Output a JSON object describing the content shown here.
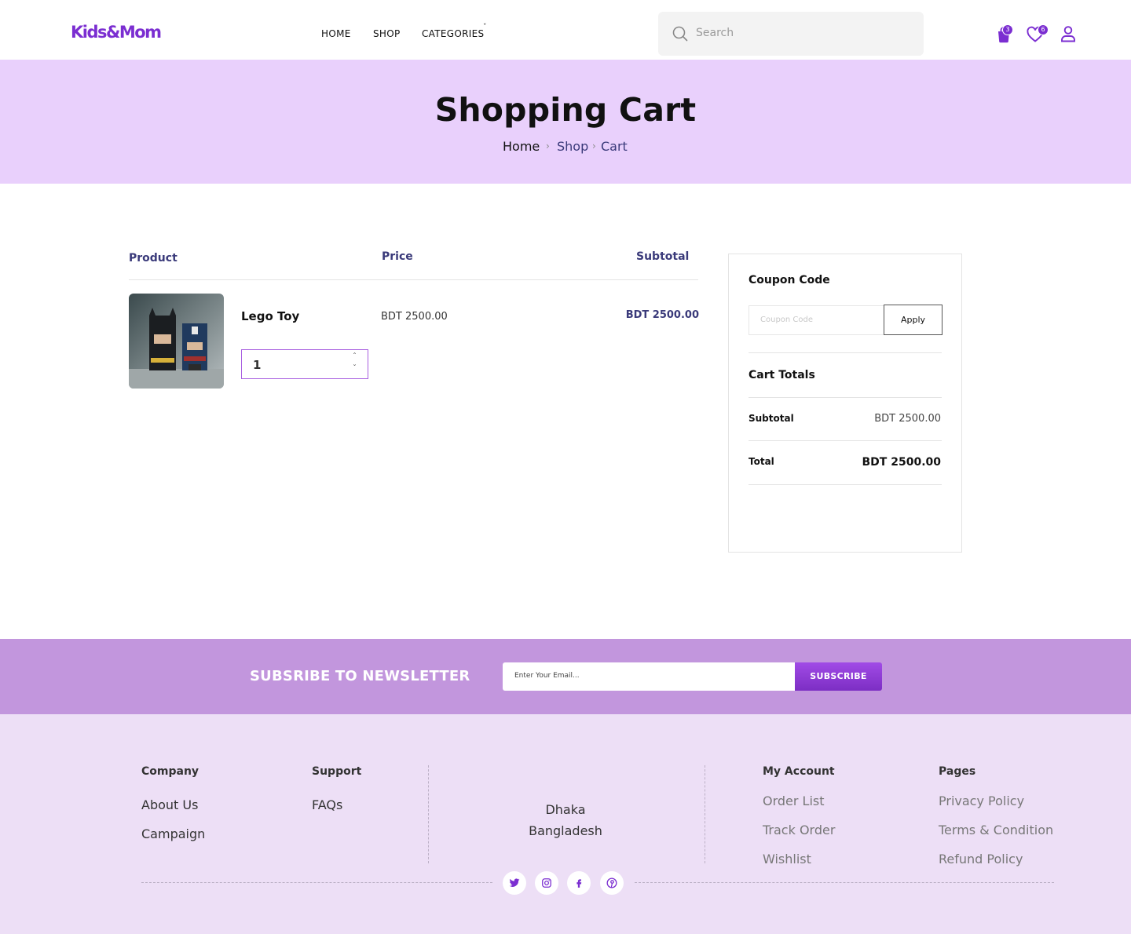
{
  "header": {
    "logo": "Kids&Mom",
    "nav": [
      "HOME",
      "SHOP",
      "CATEGORIES"
    ],
    "search_placeholder": "Search",
    "cart_count": "3",
    "wishlist_count": "6"
  },
  "banner": {
    "title": "Shopping Cart",
    "breadcrumb": [
      "Home",
      "Shop",
      "Cart"
    ]
  },
  "cart": {
    "headers": {
      "product": "Product",
      "price": "Price",
      "subtotal": "Subtotal"
    },
    "items": [
      {
        "name": "Lego Toy",
        "quantity": "1",
        "price": "BDT 2500.00",
        "subtotal": "BDT 2500.00"
      }
    ]
  },
  "summary": {
    "coupon_title": "Coupon Code",
    "coupon_placeholder": "Coupon Code",
    "apply_label": "Apply",
    "totals_title": "Cart Totals",
    "subtotal_label": "Subtotal",
    "subtotal_value": "BDT 2500.00",
    "total_label": "Total",
    "total_value": "BDT 2500.00"
  },
  "newsletter": {
    "label": "SUBSRIBE TO NEWSLETTER",
    "email_placeholder": "Enter Your Email...",
    "button": "SUBSCRIBE"
  },
  "footer": {
    "company": {
      "title": "Company",
      "links": [
        "About Us",
        "Campaign"
      ]
    },
    "support": {
      "title": "Support",
      "links": [
        "FAQs"
      ]
    },
    "address": [
      "Dhaka",
      "Bangladesh"
    ],
    "account": {
      "title": "My Account",
      "links": [
        "Order List",
        "Track Order",
        "Wishlist"
      ]
    },
    "pages": {
      "title": "Pages",
      "links": [
        "Privacy Policy",
        "Terms & Condition",
        "Refund Policy"
      ]
    },
    "social": [
      "twitter-icon",
      "instagram-icon",
      "facebook-icon",
      "pinterest-icon"
    ]
  },
  "colors": {
    "brand": "#7b2ed1",
    "banner": "#e9d0fc",
    "newsletter": "#c296dd",
    "footer": "#eddff6",
    "heading_blue": "#3a3a7a"
  }
}
